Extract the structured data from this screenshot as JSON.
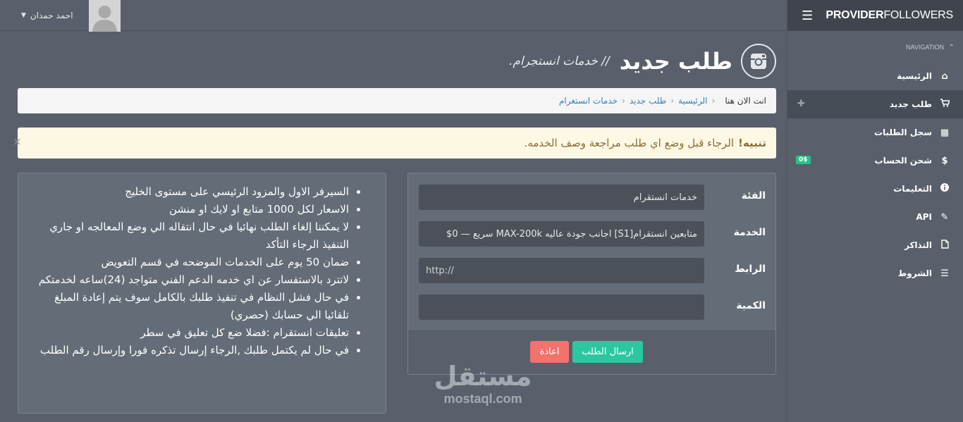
{
  "topbar": {
    "user_name": "احمد حمدان"
  },
  "brand": {
    "logo_bold": "PROVIDER",
    "logo_light": "FOLLOWERS"
  },
  "sidebar": {
    "nav_title": "NAVIGATION",
    "items": [
      {
        "label": "الرئيسية",
        "icon": "home-icon"
      },
      {
        "label": "طلب جديد",
        "icon": "cart-icon"
      },
      {
        "label": "سجل الطلبات",
        "icon": "calendar-icon"
      },
      {
        "label": "شحن الحساب",
        "icon": "dollar-icon",
        "badge": "0$"
      },
      {
        "label": "التعليمات",
        "icon": "info-icon"
      },
      {
        "label": "API",
        "icon": "magic-wand-icon"
      },
      {
        "label": "التذاكر",
        "icon": "file-icon"
      },
      {
        "label": "الشروط",
        "icon": "list-icon"
      }
    ]
  },
  "header": {
    "title": "طلب جديد",
    "subtitle": "// خدمات انستجرام."
  },
  "breadcrumb": {
    "here": "انت الان هنا",
    "items": [
      "الرئيسية",
      "طلب جديد",
      "خدمات انستغرام"
    ]
  },
  "alert": {
    "strong": "تنبيه!",
    "text": "الرجاء قبل وضع اي طلب مراجعة وصف الخدمه."
  },
  "info": {
    "items": [
      "السيرفر الاول والمزود الرئيسي على مستوى الخليج",
      "الاسعار لكل 1000 متابع او لايك او منشن",
      "لا يمكننا إلغاء الطلب نهائيا في حال انتقاله الي وضع المعالجه او جاري التنفيذ الرجاء التأكد",
      "ضمان 50 يوم على الخدمات الموضحه في قسم التعويض",
      "لاتترد بالاستفسار عن اي خدمه الدعم الفني متواجد (24)ساعه لخدمتكم",
      "في حال فشل النظام في تنفيذ طلبك بالكامل سوف يتم إعادة المبلغ تلقائيا الي حسابك (حصري)",
      "تعليقات انستقرام :فضلا ضع كل تعليق في سطر",
      "في حال لم يكتمل طلبك ,الرجاء إرسال تذكره فورا وإرسال رقم الطلب"
    ]
  },
  "form": {
    "category_label": "الفئة",
    "category_value": "خدمات انستقرام",
    "service_label": "الخدمة",
    "service_value": "متابعين انستقرام[S1] اجانب جودة عاليه MAX-200k سريع — 0$",
    "link_label": "الرابط",
    "link_placeholder": "http://",
    "quantity_label": "الكمية",
    "quantity_value": "",
    "submit_label": "ارسال الطلب",
    "reset_label": "اعادة"
  },
  "watermark": {
    "arabic": "مستقل",
    "latin": "mostaql.com"
  }
}
